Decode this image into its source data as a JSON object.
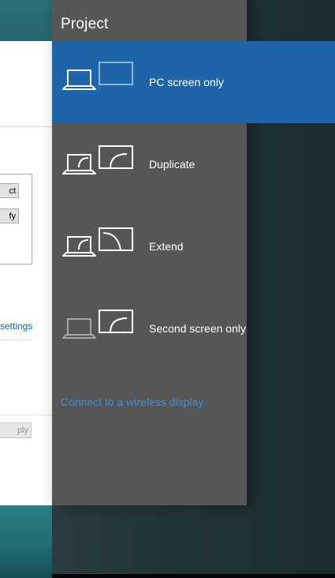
{
  "background_window": {
    "button_1": "ct",
    "button_2": "fy",
    "link": "settings",
    "apply": "ply"
  },
  "flyout": {
    "title": "Project",
    "options": [
      {
        "label": "PC screen only",
        "selected": true,
        "icon": "pc-screen-only-icon"
      },
      {
        "label": "Duplicate",
        "selected": false,
        "icon": "duplicate-icon"
      },
      {
        "label": "Extend",
        "selected": false,
        "icon": "extend-icon"
      },
      {
        "label": "Second screen only",
        "selected": false,
        "icon": "second-screen-only-icon"
      }
    ],
    "wireless_link": "Connect to a wireless display"
  },
  "colors": {
    "panel": "#565656",
    "selected": "#1e64a8",
    "link": "#3f8fd6"
  }
}
